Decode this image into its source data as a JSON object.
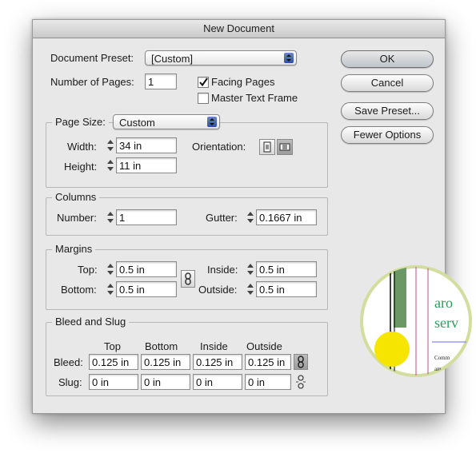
{
  "window": {
    "title": "New Document"
  },
  "top": {
    "preset_label": "Document Preset:",
    "preset_value": "[Custom]",
    "pages_label": "Number of Pages:",
    "pages_value": "1",
    "facing_pages_label": "Facing Pages",
    "facing_pages_checked": true,
    "master_text_frame_label": "Master Text Frame",
    "master_text_frame_checked": false
  },
  "buttons": {
    "ok": "OK",
    "cancel": "Cancel",
    "save_preset": "Save Preset...",
    "fewer_options": "Fewer Options"
  },
  "page_size": {
    "label": "Page Size:",
    "value": "Custom",
    "width_label": "Width:",
    "width_value": "34 in",
    "height_label": "Height:",
    "height_value": "11 in",
    "orientation_label": "Orientation:",
    "orientation_selected": "landscape"
  },
  "columns": {
    "title": "Columns",
    "number_label": "Number:",
    "number_value": "1",
    "gutter_label": "Gutter:",
    "gutter_value": "0.1667 in"
  },
  "margins": {
    "title": "Margins",
    "top_label": "Top:",
    "top_value": "0.5 in",
    "bottom_label": "Bottom:",
    "bottom_value": "0.5 in",
    "inside_label": "Inside:",
    "inside_value": "0.5 in",
    "outside_label": "Outside:",
    "outside_value": "0.5 in"
  },
  "bleed_slug": {
    "title": "Bleed and Slug",
    "col_top": "Top",
    "col_bottom": "Bottom",
    "col_inside": "Inside",
    "col_outside": "Outside",
    "bleed_label": "Bleed:",
    "bleed_values": [
      "0.125 in",
      "0.125 in",
      "0.125 in",
      "0.125 in"
    ],
    "slug_label": "Slug:",
    "slug_values": [
      "0 in",
      "0 in",
      "0 in",
      "0 in"
    ]
  },
  "magnifier": {
    "line1": "aro",
    "line2": "serv",
    "small1": "Comm",
    "small2": "am"
  },
  "colors": {
    "magnifier_fill": "#d3dd9d",
    "accent_green": "#2e9a5e",
    "yellow_circle": "#f6e500",
    "bar_green": "#6a9965",
    "default_button": "#c6cdd6"
  }
}
